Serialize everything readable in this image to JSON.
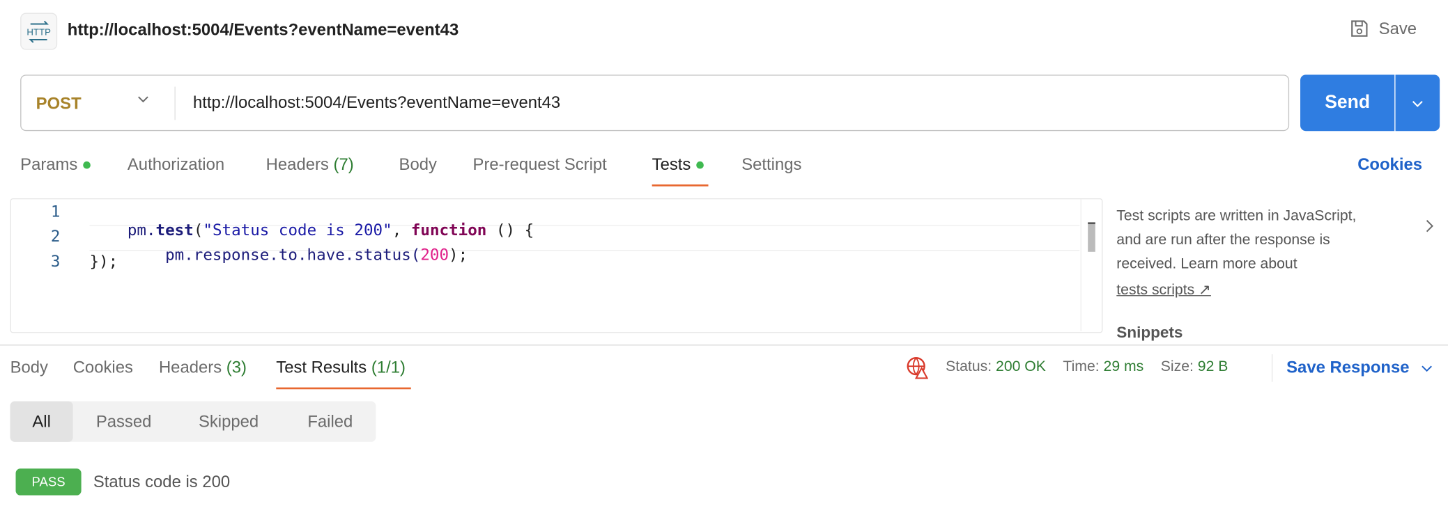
{
  "header": {
    "icon": "http-icon",
    "title": "http://localhost:5004/Events?eventName=event43",
    "save_label": "Save"
  },
  "request": {
    "method": "POST",
    "url": "http://localhost:5004/Events?eventName=event43",
    "send_label": "Send"
  },
  "request_tabs": {
    "params": "Params",
    "authorization": "Authorization",
    "headers": "Headers",
    "headers_count": "(7)",
    "body": "Body",
    "prerequest": "Pre-request Script",
    "tests": "Tests",
    "settings": "Settings",
    "cookies": "Cookies"
  },
  "editor": {
    "line_numbers": [
      "1",
      "2",
      "3"
    ],
    "line1": {
      "a": "pm.",
      "b": "test",
      "c": "(",
      "d": "\"Status code is 200\"",
      "e": ", ",
      "f": "function",
      "g": " () {"
    },
    "line2": {
      "a": "    pm.response.to.have.status(",
      "b": "200",
      "c": ");"
    },
    "line3": "});"
  },
  "side_panel": {
    "line1": "Test scripts are written in JavaScript,",
    "line2": "and are run after the response is",
    "line3": "received. Learn more about",
    "link": "tests scripts ↗",
    "snippets": "Snippets"
  },
  "response_tabs": {
    "body": "Body",
    "cookies": "Cookies",
    "headers": "Headers",
    "headers_count": "(3)",
    "test_results": "Test Results",
    "test_results_count": "(1/1)"
  },
  "status": {
    "status_label": "Status:",
    "status_value": "200 OK",
    "time_label": "Time:",
    "time_value": "29 ms",
    "size_label": "Size:",
    "size_value": "92 B",
    "save_response": "Save Response"
  },
  "filters": [
    "All",
    "Passed",
    "Skipped",
    "Failed"
  ],
  "results": [
    {
      "badge": "PASS",
      "name": "Status code is 200"
    }
  ],
  "colors": {
    "accent": "#2f7de1",
    "method": "#a8832a",
    "pass": "#4caf50",
    "tab_underline": "#e8672f",
    "link": "#1f62c9"
  }
}
